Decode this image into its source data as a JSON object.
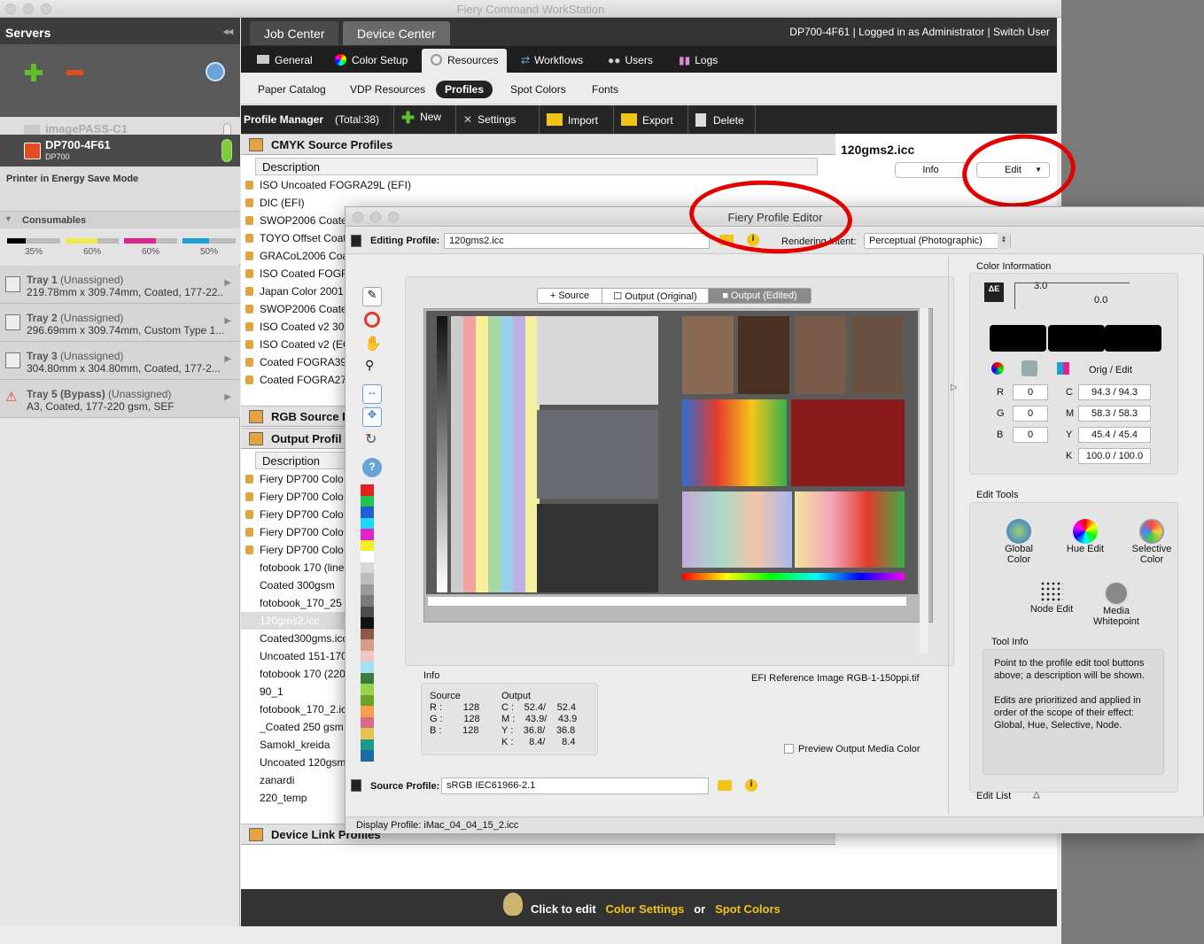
{
  "window": {
    "title": "Fiery Command WorkStation"
  },
  "servers": {
    "heading": "Servers",
    "items": [
      {
        "name": "imagePASS-C1",
        "model": "3220"
      },
      {
        "name": "DP700-4F61",
        "model": "DP700"
      }
    ],
    "status": "Printer in Energy Save Mode",
    "consumables_label": "Consumables",
    "consumables": [
      "35%",
      "60%",
      "60%",
      "50%"
    ],
    "trays": [
      {
        "name": "Tray 1",
        "state": "(Unassigned)",
        "desc": "219.78mm x 309.74mm, Coated, 177-22..."
      },
      {
        "name": "Tray 2",
        "state": "(Unassigned)",
        "desc": "296.69mm x 309.74mm, Custom Type 1..."
      },
      {
        "name": "Tray 3",
        "state": "(Unassigned)",
        "desc": "304.80mm x 304.80mm, Coated, 177-2..."
      },
      {
        "name": "Tray 5 (Bypass)",
        "state": "(Unassigned)",
        "desc": "A3, Coated, 177-220 gsm, SEF"
      }
    ]
  },
  "topnav": {
    "tabs": [
      "Job Center",
      "Device Center"
    ],
    "status": "DP700-4F61 | Logged in as Administrator | Switch User"
  },
  "subnav": [
    "General",
    "Color Setup",
    "Resources",
    "Workflows",
    "Users",
    "Logs"
  ],
  "resnav": [
    "Paper Catalog",
    "VDP Resources",
    "Profiles",
    "Spot Colors",
    "Fonts"
  ],
  "toolbar": {
    "title": "Profile Manager",
    "total": "(Total:38)",
    "buttons": [
      "New",
      "Settings",
      "Import",
      "Export",
      "Delete"
    ]
  },
  "sections": {
    "cmyk": "CMYK Source Profiles",
    "rgb": "RGB Source P",
    "output": "Output Profil",
    "devlink": "Device Link Profiles",
    "description": "Description"
  },
  "cmyk_profiles": [
    "ISO Uncoated FOGRA29L (EFI)",
    "DIC (EFI)",
    "SWOP2006 Coate",
    "TOYO Offset Coate",
    "GRACoL2006 Coa",
    "ISO Coated FOGRA",
    "Japan Color 2001",
    "SWOP2006 Coate",
    "ISO Coated v2 300",
    "ISO Coated v2 (EC",
    "Coated FOGRA39",
    "Coated FOGRA27"
  ],
  "output_profiles": [
    "Fiery DP700 Colo",
    "Fiery DP700 Colo",
    "Fiery DP700 Colo",
    "Fiery DP700 Colo",
    "Fiery DP700 Colo",
    "fotobook 170 (line",
    "Coated 300gsm",
    "fotobook_170_25",
    "120gms2.icc",
    "Coated300gms.icc",
    "Uncoated 151-170",
    "fotobook 170 (220",
    "90_1",
    "fotobook_170_2.ic",
    "_Coated 250 gsm",
    "Samokl_kreida",
    "Uncoated 120gsm",
    "zanardi",
    "220_temp"
  ],
  "selected_profile": {
    "name": "120gms2.icc",
    "info_btn": "Info",
    "edit_btn": "Edit"
  },
  "bottombar": {
    "prefix": "Click to edit",
    "link1": "Color Settings",
    "or": "or",
    "link2": "Spot Colors"
  },
  "editor": {
    "title": "Fiery Profile Editor",
    "editing_label": "Editing Profile:",
    "editing_value": "120gms2.icc",
    "intent_label": "Rendering Intent:",
    "intent_value": "Perceptual (Photographic)",
    "view_tabs": [
      "Source",
      "Output (Original)",
      "Output (Edited)"
    ],
    "image_name": "EFI Reference Image RGB-1-150ppi.tif",
    "info": {
      "title": "Info",
      "source_label": "Source",
      "output_label": "Output",
      "source": [
        [
          "R :",
          "128"
        ],
        [
          "G :",
          "128"
        ],
        [
          "B :",
          "128"
        ]
      ],
      "output": [
        [
          "C :",
          "52.4/",
          "52.4"
        ],
        [
          "M :",
          "43.9/",
          "43.9"
        ],
        [
          "Y :",
          "36.8/",
          "36.8"
        ],
        [
          "K :",
          "8.4/",
          "8.4"
        ]
      ]
    },
    "preview_label": "Preview Output Media Color",
    "source_profile_label": "Source Profile:",
    "source_profile_value": "sRGB IEC61966-2.1",
    "display_profile": "Display Profile:  iMac_04_04_15_2.icc",
    "color_info": {
      "title": "Color Information",
      "delta_e": "3.0",
      "delta_small": "0.0",
      "orig_edit": "Orig / Edit",
      "rgb": [
        [
          "R",
          "0"
        ],
        [
          "G",
          "0"
        ],
        [
          "B",
          "0"
        ]
      ],
      "cmyk": [
        [
          "C",
          "94.3 / 94.3"
        ],
        [
          "M",
          "58.3 / 58.3"
        ],
        [
          "Y",
          "45.4 / 45.4"
        ],
        [
          "K",
          "100.0 / 100.0"
        ]
      ]
    },
    "edit_tools": {
      "title": "Edit Tools",
      "tools": [
        "Global Color",
        "Hue Edit",
        "Selective Color",
        "Node Edit",
        "Media Whitepoint"
      ]
    },
    "tool_info": {
      "title": "Tool Info",
      "text1": "Point to the profile edit tool buttons above; a description will be shown.",
      "text2": "Edits are prioritized and applied in order of the scope of their effect: Global, Hue, Selective, Node."
    },
    "edit_list": "Edit List"
  },
  "colors": {
    "accent_yellow": "#f0c419",
    "annotation_red": "#e40000",
    "dark_bar": "#262626"
  }
}
